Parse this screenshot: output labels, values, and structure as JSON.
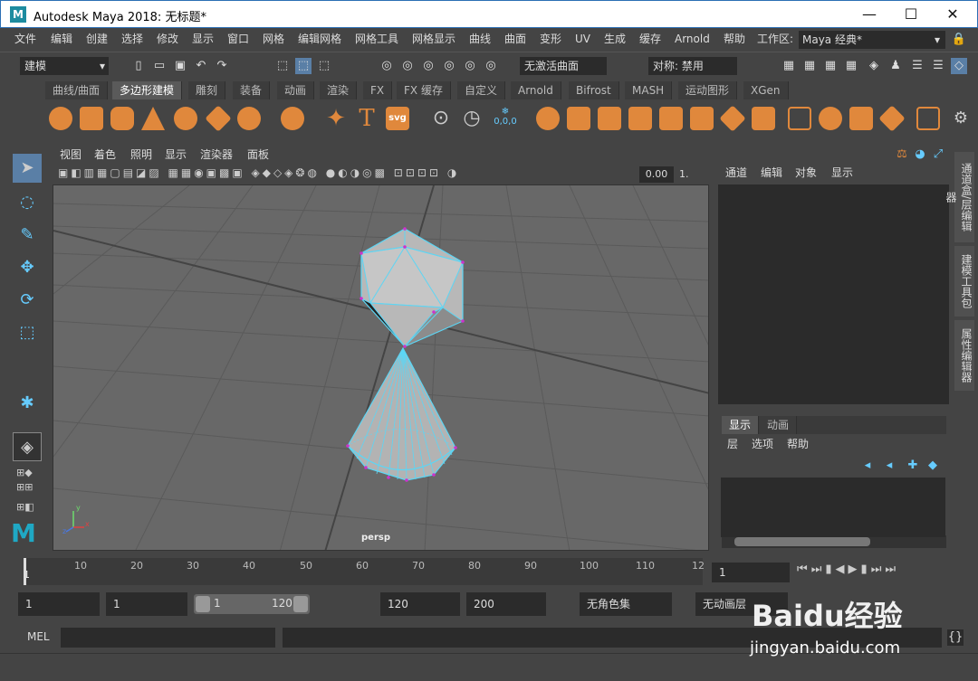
{
  "window": {
    "title": "Autodesk Maya 2018: 无标题*",
    "logo": "M",
    "minimize": "—",
    "maximize": "☐",
    "close": "✕"
  },
  "menus": [
    "文件",
    "编辑",
    "创建",
    "选择",
    "修改",
    "显示",
    "窗口",
    "网格",
    "编辑网格",
    "网格工具",
    "网格显示",
    "曲线",
    "曲面",
    "变形",
    "UV",
    "生成",
    "缓存",
    "Arnold",
    "帮助"
  ],
  "workspace": {
    "label": "工作区:",
    "value": "Maya 经典*"
  },
  "status": {
    "mode": "建模",
    "live_surface": "无激活曲面",
    "symmetry": "对称: 禁用"
  },
  "shelf_tabs": [
    "曲线/曲面",
    "多边形建模",
    "雕刻",
    "装备",
    "动画",
    "渲染",
    "FX",
    "FX 缓存",
    "自定义",
    "Arnold",
    "Bifrost",
    "MASH",
    "运动图形",
    "XGen"
  ],
  "shelf_active": 1,
  "shelf_text": {
    "svg": "svg",
    "text_tool": "T",
    "counter": "0,0,0"
  },
  "viewport": {
    "menus": [
      "视图",
      "着色",
      "照明",
      "显示",
      "渲染器",
      "面板"
    ],
    "field_value": "0.00",
    "field2": "1.",
    "camera": "persp",
    "axis_y": "y",
    "axis_x": "x",
    "axis_z": "z"
  },
  "channelbox": {
    "menus": [
      "通道",
      "编辑",
      "对象",
      "显示"
    ]
  },
  "layers": {
    "tabs": [
      "显示",
      "动画"
    ],
    "menus": [
      "层",
      "选项",
      "帮助"
    ]
  },
  "side_tabs": [
    "通道盒/层编辑器",
    "建模工具包",
    "属性编辑器"
  ],
  "timeline": {
    "ticks": [
      "1",
      "10",
      "20",
      "30",
      "40",
      "50",
      "60",
      "70",
      "80",
      "90",
      "100",
      "110",
      "12"
    ],
    "current": "1"
  },
  "range": {
    "start": "1",
    "start2": "1",
    "slider_start": "1",
    "slider_end": "120",
    "end": "120",
    "end2": "200",
    "char_set": "无角色集",
    "anim_layer": "无动画层"
  },
  "mel": {
    "label": "MEL"
  },
  "watermark": {
    "text": "Baidu经验",
    "url": "jingyan.baidu.com"
  },
  "colors": {
    "selection": "#5cd6f5",
    "vertex": "#cc33cc",
    "grid": "#5a5a5a",
    "accent": "#4a7ba8"
  }
}
